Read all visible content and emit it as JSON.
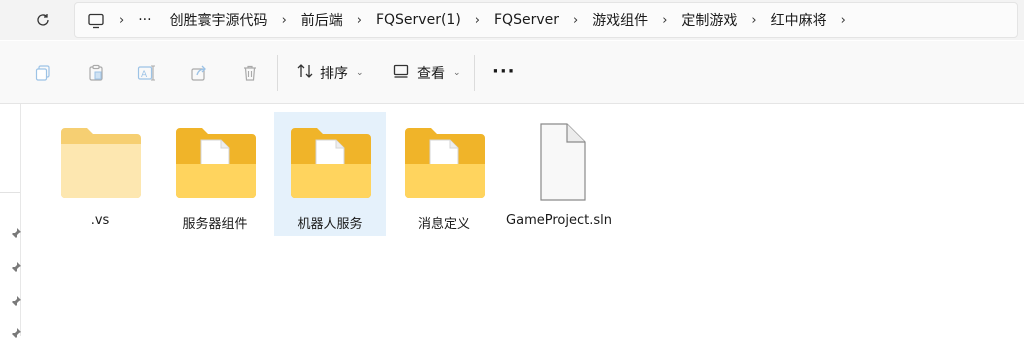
{
  "address_bar": {
    "crumbs": [
      "创胜寰宇源代码",
      "前后端",
      "FQServer(1)",
      "FQServer",
      "游戏组件",
      "定制游戏",
      "红中麻将"
    ],
    "overflow": "···"
  },
  "toolbar": {
    "sort_label": "排序",
    "view_label": "查看",
    "more_label": "···"
  },
  "files": [
    {
      "name": ".vs",
      "type": "folder-empty",
      "selected": false
    },
    {
      "name": "服务器组件",
      "type": "folder",
      "selected": false
    },
    {
      "name": "机器人服务",
      "type": "folder",
      "selected": true
    },
    {
      "name": "消息定义",
      "type": "folder",
      "selected": false
    },
    {
      "name": "GameProject.sln",
      "type": "file",
      "selected": false
    }
  ],
  "colors": {
    "folder_back": "#f0b429",
    "folder_front": "#ffd45e",
    "selection": "#e5f1fb"
  }
}
